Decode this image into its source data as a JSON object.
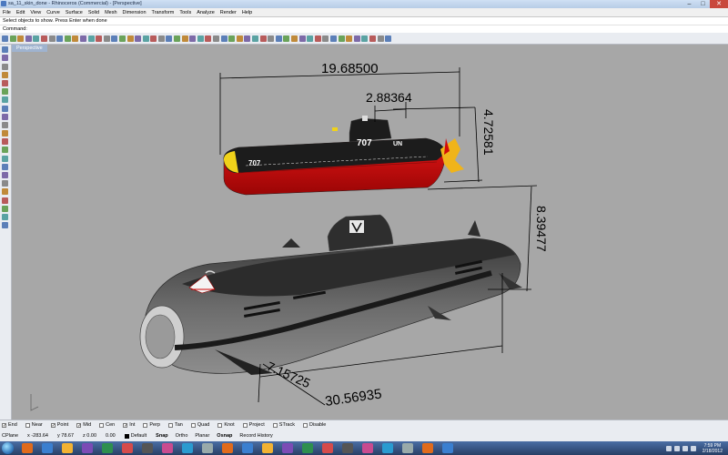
{
  "window": {
    "title": "sa_11_skin_done - Rhinoceros (Commercial) - [Perspective]",
    "buttons": [
      "–",
      "□",
      "✕"
    ]
  },
  "menubar": [
    "File",
    "Edit",
    "View",
    "Curve",
    "Surface",
    "Solid",
    "Mesh",
    "Dimension",
    "Transform",
    "Tools",
    "Analyze",
    "Render",
    "Help"
  ],
  "command_area": {
    "history": "Select objects to show. Press Enter when done",
    "prompt": "Command:"
  },
  "viewport": {
    "label": "Perspective",
    "dimensions": {
      "top_length": "19.68500",
      "top_small": "2.88364",
      "top_height": "4.72581",
      "big_height": "8.39477",
      "big_length": "30.56935",
      "big_depth": "7.15725"
    },
    "small_sub_labels": {
      "number_side": "707",
      "number_tower": "707",
      "flag": "UN"
    }
  },
  "osnaps": [
    {
      "label": "End",
      "checked": true
    },
    {
      "label": "Near",
      "checked": false
    },
    {
      "label": "Point",
      "checked": true
    },
    {
      "label": "Mid",
      "checked": true
    },
    {
      "label": "Cen",
      "checked": false
    },
    {
      "label": "Int",
      "checked": true
    },
    {
      "label": "Perp",
      "checked": false
    },
    {
      "label": "Tan",
      "checked": false
    },
    {
      "label": "Quad",
      "checked": false
    },
    {
      "label": "Knot",
      "checked": false
    },
    {
      "label": "Project",
      "checked": false
    },
    {
      "label": "STrack",
      "checked": false
    },
    {
      "label": "Disable",
      "checked": false
    }
  ],
  "status": {
    "cplane": "CPlane",
    "x": "x -283.64",
    "y": "y 78.67",
    "z": "z 0.00",
    "dist": "0.00",
    "layer": "Default",
    "panes": [
      "Snap",
      "Ortho",
      "Planar",
      "Osnap",
      "Record History"
    ]
  },
  "clock": {
    "time": "7:59 PM",
    "date": "2/18/2012"
  },
  "colors": {
    "viewport_bg": "#a7a7a7",
    "dimension_line": "#000000",
    "sub_hull_red": "#d10a0a",
    "sub_hull_black": "#1c1c1c",
    "sub_yellow": "#f0d21a",
    "big_sub_gray": "#4a4a4a"
  }
}
